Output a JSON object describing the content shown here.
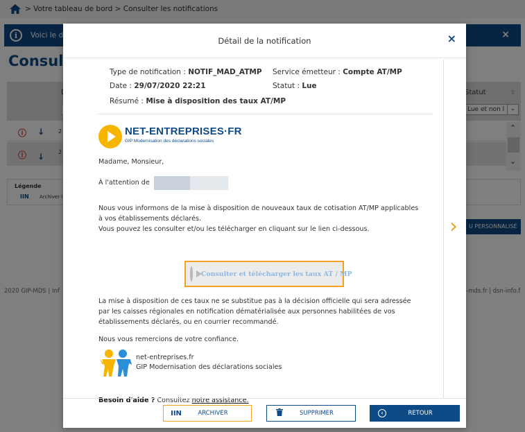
{
  "breadcrumb": "> Votre tableau de bord > Consulter les notifications",
  "info_bar": {
    "text": "Voici le d",
    "close": "×"
  },
  "page_title": "Consulte",
  "table": {
    "col_d": "D",
    "statut_header": "Statut",
    "statut_filter": "Lue et non l",
    "rows": [
      {
        "num": "2"
      },
      {
        "num": "2"
      }
    ]
  },
  "legend": {
    "title": "Légende",
    "archive": "Archiver la"
  },
  "perso_button": "U PERSONNALISÉ",
  "footer": {
    "left": "2020 GIP-MDS  |  Inf",
    "right": "-mds.fr  |  dsn-info.f"
  },
  "modal": {
    "title": "Détail de la notification",
    "close": "×",
    "next": "›",
    "meta": {
      "type_label": "Type de notification :",
      "type_value": "NOTIF_MAD_ATMP",
      "service_label": "Service émetteur :",
      "service_value": "Compte AT/MP",
      "date_label": "Date :",
      "date_value": "29/07/2020 22:21",
      "statut_label": "Statut :",
      "statut_value": "Lue",
      "resume_label": "Résumé :",
      "resume_value": "Mise à disposition des taux AT/MP"
    },
    "logo": {
      "brand": "NET-ENTREPRISES·FR",
      "tagline": "GIP Modernisation des déclarations sociales"
    },
    "greeting": "Madame, Monsieur,",
    "attention": "À l'attention de",
    "para1_l1": "Nous vous informons de la mise à disposition de nouveaux taux de cotisation AT/MP applicables",
    "para1_l2": "à vos établissements déclarés.",
    "para1_l3": "Vous pouvez les consulter et/ou les télécharger en cliquant sur le lien ci-dessous.",
    "media_button": "Consulter et télécharger les taux AT / MP",
    "para2_l1": "La mise à disposition de ces taux ne se substitue pas à la décision officielle qui sera adressée",
    "para2_l2": "par les caisses régionales en notification dématérialisée aux personnes habilitées de vos",
    "para2_l3": "établissements déclarés, ou en courrier recommandé.",
    "thanks": "Nous vous remercions de votre confiance.",
    "signature_l1": "net-entreprises.fr",
    "signature_l2": "GIP Modernisation des déclarations sociales",
    "help_bold": "Besoin d'aide ?",
    "help_text": " Consultez ",
    "help_link": "notre assistance.",
    "buttons": {
      "archive": "ARCHIVER",
      "delete": "SUPPRIMER",
      "back": "RETOUR"
    }
  },
  "colors": {
    "primary": "#0e4a86",
    "accent": "#f2a223",
    "logo_yellow": "#f7b500",
    "error": "#d32f2f"
  },
  "icons": [
    "home-icon",
    "info-icon",
    "close-icon",
    "error-icon",
    "arrow-down-icon",
    "archive-icon",
    "trash-icon",
    "back-icon",
    "play-icon",
    "chevron-right-icon"
  ]
}
